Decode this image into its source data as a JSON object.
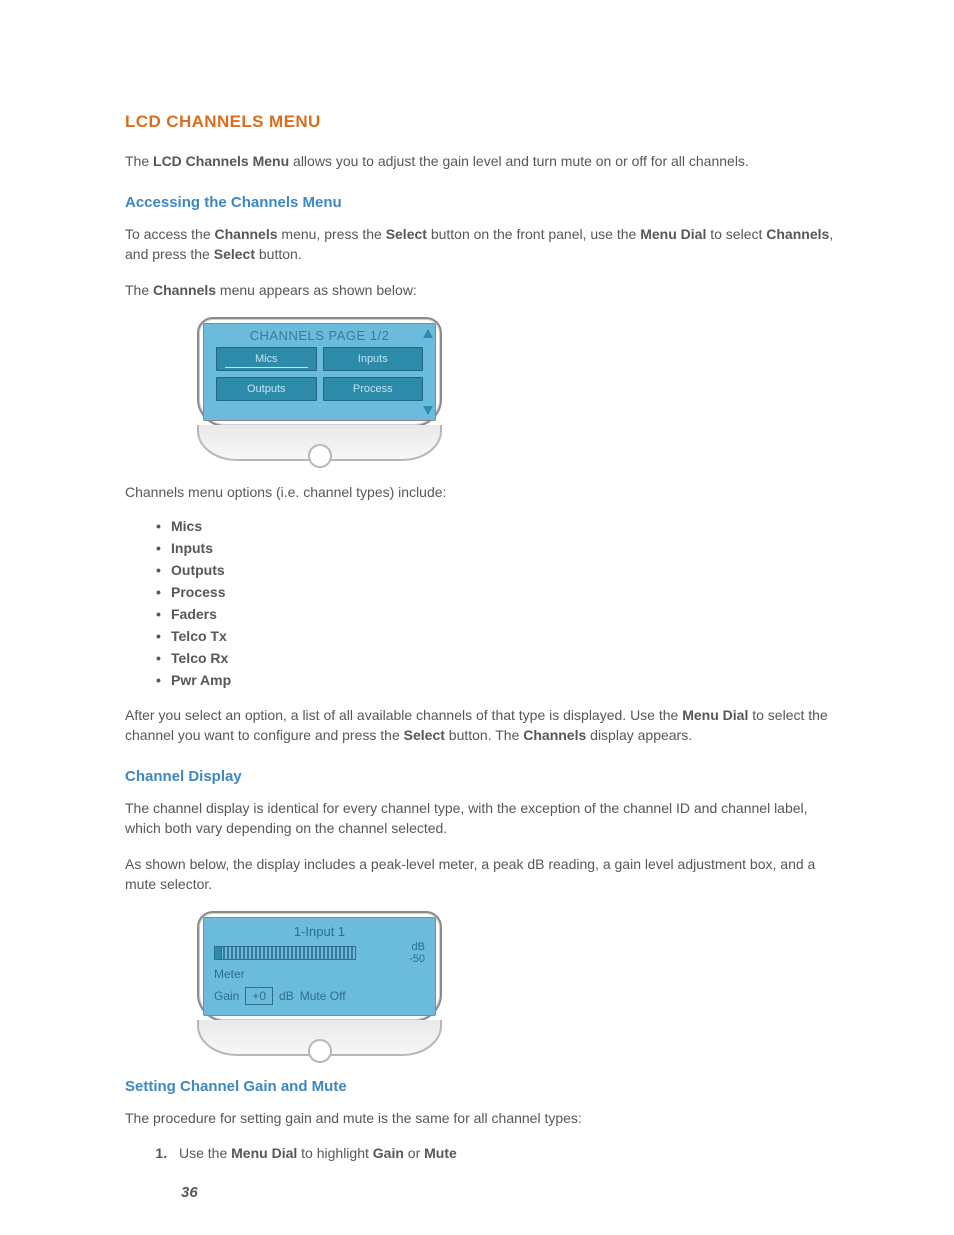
{
  "title": "LCD CHANNELS MENU",
  "intro": {
    "pre": "The ",
    "bold": "LCD Channels Menu",
    "post": " allows you to adjust the gain level and turn mute on or off for all channels."
  },
  "sec1": {
    "heading": "Accessing the Channels Menu",
    "p1": {
      "t0": "To access the ",
      "b0": "Channels",
      "t1": " menu, press the ",
      "b1": "Select",
      "t2": " button on the front panel, use the ",
      "b2": "Menu Dial",
      "t3": " to select ",
      "b3": "Channels",
      "t4": ", and press the ",
      "b4": "Select",
      "t5": " button."
    },
    "p2": {
      "t0": "The ",
      "b0": "Channels",
      "t1": " menu appears as shown below:"
    }
  },
  "lcd1": {
    "title": "CHANNELS PAGE 1/2",
    "btns": [
      "Mics",
      "Inputs",
      "Outputs",
      "Process"
    ]
  },
  "opts_intro": "Channels menu options (i.e. channel types) include:",
  "opts": [
    "Mics",
    "Inputs",
    "Outputs",
    "Process",
    "Faders",
    "Telco Tx",
    "Telco Rx",
    "Pwr Amp"
  ],
  "after_opts": {
    "t0": "After you select an option, a list of all available channels of that type is displayed. Use the ",
    "b0": "Menu Dial",
    "t1": " to select the channel you want to configure and press the ",
    "b1": "Select",
    "t2": " button. The ",
    "b2": "Channels",
    "t3": " display appears."
  },
  "sec2": {
    "heading": "Channel Display",
    "p1": "The channel display is identical for every channel type, with the exception of the channel ID and channel label, which both vary depending on the channel selected.",
    "p2": "As shown below, the display includes a peak-level meter, a peak dB reading, a gain level adjustment box, and a mute selector."
  },
  "lcd2": {
    "header": "1-Input 1",
    "db_label": "dB",
    "db_value": "-50",
    "meter_label": "Meter",
    "gain_label": "Gain",
    "gain_value": "+0",
    "db_unit": "dB",
    "mute_label": "Mute Off"
  },
  "sec3": {
    "heading": "Setting Channel Gain and Mute",
    "p1": "The procedure for setting gain and mute is the same for all channel types:",
    "step1": {
      "t0": "Use the ",
      "b0": "Menu Dial",
      "t1": " to highlight ",
      "b1": "Gain",
      "t2": " or ",
      "b2": "Mute"
    }
  },
  "page_number": "36"
}
